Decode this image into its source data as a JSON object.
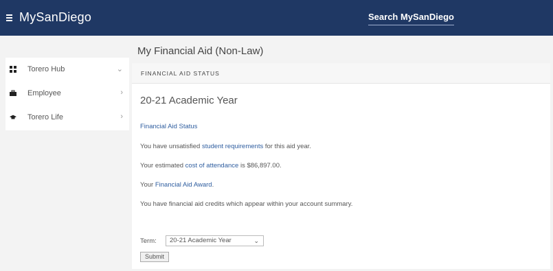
{
  "header": {
    "brand": "MySanDiego",
    "search_label": "Search MySanDiego"
  },
  "sidebar": {
    "items": [
      {
        "label": "Torero Hub",
        "icon": "dashboard-icon",
        "chevron": "⌄"
      },
      {
        "label": "Employee",
        "icon": "briefcase-icon",
        "chevron": "›"
      },
      {
        "label": "Torero Life",
        "icon": "graduation-cap-icon",
        "chevron": "›"
      }
    ]
  },
  "main": {
    "page_title": "My Financial Aid (Non-Law)",
    "section_title": "FINANCIAL AID STATUS",
    "year_heading": "20-21 Academic Year",
    "status_link": "Financial Aid Status",
    "requirements": {
      "prefix": "You have unsatisfied ",
      "link": "student requirements",
      "suffix": " for this aid year."
    },
    "cost": {
      "prefix": "Your estimated ",
      "link": "cost of attendance",
      "suffix": " is $86,897.00."
    },
    "award": {
      "prefix": "Your ",
      "link": "Financial Aid Award",
      "suffix": "."
    },
    "credits_text": "You have financial aid credits which appear within your account summary.",
    "term_label": "Term:",
    "term_value": "20-21 Academic Year",
    "submit_label": "Submit"
  },
  "colors": {
    "header_bg": "#1f3864",
    "link": "#2e5d9f"
  }
}
